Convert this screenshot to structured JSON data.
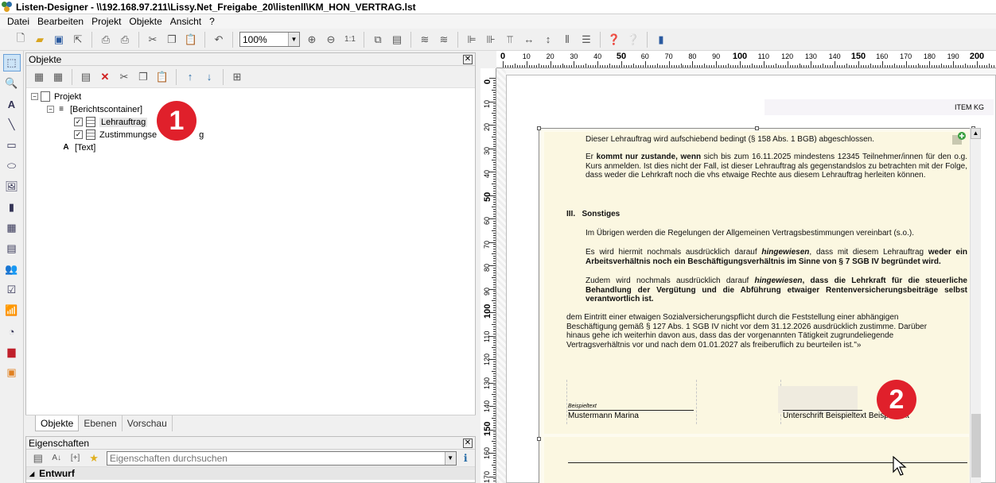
{
  "window": {
    "title": "Listen-Designer - \\\\192.168.97.211\\Lissy.Net_Freigabe_20\\listenll\\KM_HON_VERTRAG.lst"
  },
  "menu": [
    "Datei",
    "Bearbeiten",
    "Projekt",
    "Objekte",
    "Ansicht",
    "?"
  ],
  "toolbar": {
    "zoom": "100%",
    "ratio_label": "1:1"
  },
  "objects_panel": {
    "title": "Objekte",
    "tree": {
      "root": "Projekt",
      "container": "[Berichtscontainer]",
      "item1": "Lehrauftrag",
      "item2": "Zustimmungse",
      "item2_suffix": "g",
      "text": "[Text]"
    },
    "tabs": [
      "Objekte",
      "Ebenen",
      "Vorschau"
    ]
  },
  "properties_panel": {
    "title": "Eigenschaften",
    "search_placeholder": "Eigenschaften durchsuchen",
    "group": "Entwurf",
    "list_mode_label": "[+]"
  },
  "badges": {
    "one": "1",
    "two": "2"
  },
  "ruler": {
    "h": [
      "0",
      "10",
      "20",
      "30",
      "40",
      "50",
      "60",
      "70",
      "80",
      "90",
      "100",
      "110",
      "120",
      "130",
      "140",
      "150",
      "160",
      "170",
      "180",
      "190",
      "200"
    ],
    "v": [
      "0",
      "10",
      "20",
      "30",
      "40",
      "50",
      "60",
      "70",
      "80",
      "90",
      "100",
      "110",
      "120",
      "130",
      "140",
      "150",
      "160",
      "170"
    ]
  },
  "document": {
    "header_right": "ITEM KG",
    "p1": "Dieser Lehrauftrag wird aufschiebend bedingt (§ 158 Abs. 1 BGB) abgeschlossen.",
    "p2_a": "Er ",
    "p2_b": "kommt nur zustande, wenn",
    "p2_c": " sich bis zum 16.11.2025 mindestens 12345 Teilnehmer/innen für den o.g. Kurs anmelden. Ist dies nicht der Fall, ist dieser Lehrauftrag als gegenstandslos zu betrachten mit der Folge, dass weder die Lehrkraft noch die vhs etwaige Rechte aus diesem Lehrauftrag herleiten können.",
    "section": "III.   Sonstiges",
    "p3": "Im Übrigen werden die Regelungen der Allgemeinen Vertragsbestimmungen vereinbart (s.o.).",
    "p4_a": "Es wird hiermit nochmals ausdrücklich darauf ",
    "p4_b": "hingewiesen",
    "p4_c": ", dass mit diesem Lehrauftrag ",
    "p4_d": "weder ein Arbeitsverhältnis noch ein Beschäftigungsverhältnis im Sinne von § 7 SGB IV begründet wird.",
    "p5_a": "Zudem wird nochmals ausdrücklich darauf ",
    "p5_b": "hingewiesen",
    "p5_c": ", dass die Lehrkraft für die steuerliche Behandlung der Vergütung und die Abführung etwaiger Rentenversicherungsbeiträge selbst verantwortlich ist.",
    "p6": " dem Eintritt einer etwaigen Sozialversicherungspflicht durch die Feststellung einer abhängigen Beschäftigung gemäß § 127 Abs. 1 SGB IV nicht vor dem 31.12.2026 ausdrücklich zustimme. Darüber hinaus gehe ich weiterhin davon aus, dass das der vorgenannten Tätigkeit zugrundeliegende Vertragsverhältnis vor und nach dem 01.01.2027 als freiberuflich zu beurteilen ist.\"»",
    "sig_small": "Beispieltext",
    "sig_left": "Mustermann Marina",
    "sig_right": "Unterschrift Beispieltext Beispieltext"
  }
}
